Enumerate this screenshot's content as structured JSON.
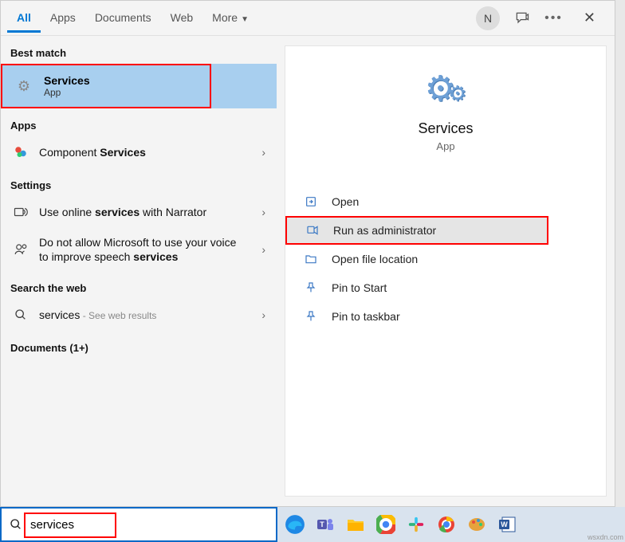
{
  "tabs": {
    "all": "All",
    "apps": "Apps",
    "documents": "Documents",
    "web": "Web",
    "more": "More"
  },
  "avatar_initial": "N",
  "sections": {
    "best_match": "Best match",
    "apps": "Apps",
    "settings": "Settings",
    "search_web": "Search the web",
    "documents": "Documents (1+)"
  },
  "best_match": {
    "title": "Services",
    "subtitle": "App"
  },
  "apps_result": {
    "prefix": "Component ",
    "bold": "Services"
  },
  "settings_results": [
    {
      "pre": "Use online ",
      "b": "services",
      "post": " with Narrator"
    },
    {
      "pre": "Do not allow Microsoft to use your voice to improve speech ",
      "b": "services",
      "post": ""
    }
  ],
  "web_result": {
    "term": "services",
    "hint": " - See web results"
  },
  "detail": {
    "title": "Services",
    "subtitle": "App",
    "actions": {
      "open": "Open",
      "run_admin": "Run as administrator",
      "open_loc": "Open file location",
      "pin_start": "Pin to Start",
      "pin_taskbar": "Pin to taskbar"
    }
  },
  "search": {
    "value": "services"
  },
  "watermark": "wsxdn.com"
}
